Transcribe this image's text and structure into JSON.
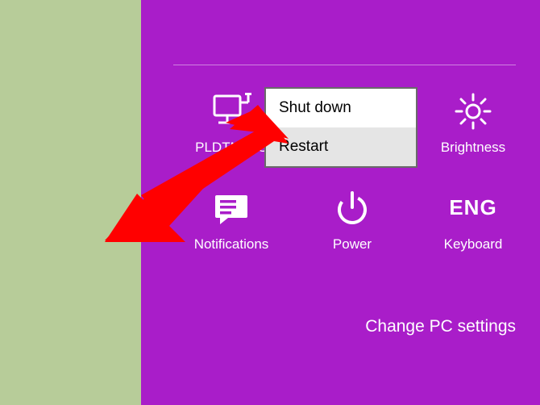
{
  "tiles": {
    "network": {
      "label": "PLDTMyDS"
    },
    "brightness": {
      "label": "Brightness"
    },
    "notifications": {
      "label": "Notifications"
    },
    "power": {
      "label": "Power"
    },
    "keyboard": {
      "label": "Keyboard",
      "lang": "ENG"
    }
  },
  "popup": {
    "shutdown": "Shut down",
    "restart": "Restart"
  },
  "footer": {
    "changeSettings": "Change PC settings"
  }
}
